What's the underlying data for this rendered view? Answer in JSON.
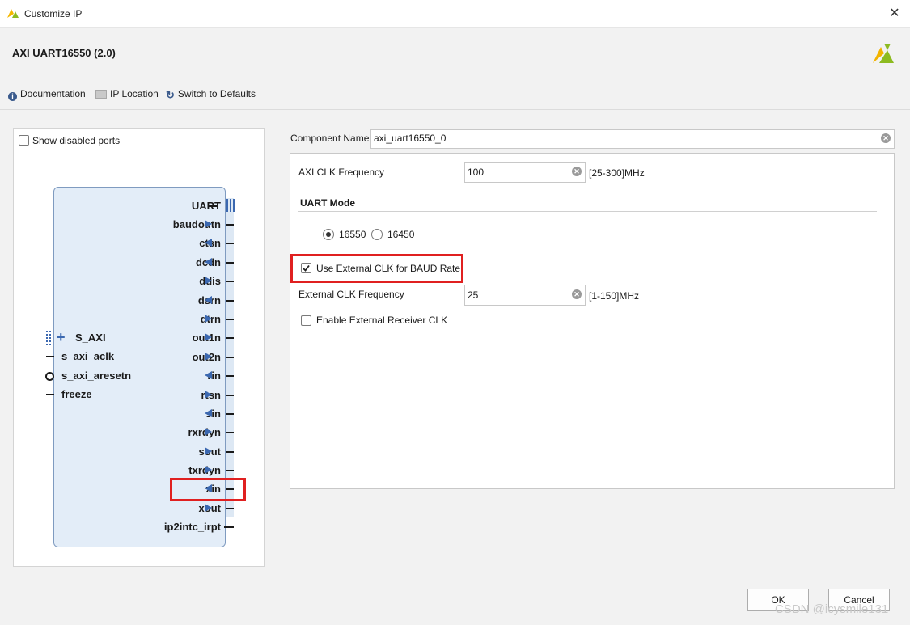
{
  "window": {
    "title": "Customize IP",
    "close_glyph": "✕"
  },
  "header": {
    "ip_name": "AXI UART16550 (2.0)",
    "logo_icon": "xilinx-logo-icon"
  },
  "toolbar": {
    "documentation": "Documentation",
    "ip_location": "IP Location",
    "switch_defaults": "Switch to Defaults"
  },
  "left_panel": {
    "show_disabled_ports": "Show disabled ports",
    "show_disabled_checked": false,
    "block": {
      "right_ports": [
        "UART",
        "baudoutn",
        "ctsn",
        "dcdn",
        "ddis",
        "dsrn",
        "dtrn",
        "out1n",
        "out2n",
        "rin",
        "rtsn",
        "sin",
        "rxrdyn",
        "sout",
        "txrdyn",
        "xin",
        "xout",
        "ip2intc_irpt"
      ],
      "left_ports": [
        "S_AXI",
        "s_axi_aclk",
        "s_axi_aresetn",
        "freeze"
      ]
    }
  },
  "form": {
    "component_name_label": "Component Name",
    "component_name_value": "axi_uart16550_0",
    "axi_clk_label": "AXI CLK Frequency",
    "axi_clk_value": "100",
    "axi_clk_range": "[25-300]MHz",
    "uart_mode_title": "UART Mode",
    "mode_options": [
      "16550",
      "16450"
    ],
    "mode_selected": "16550",
    "use_ext_clk_label": "Use External CLK for BAUD Rate",
    "use_ext_clk_checked": true,
    "ext_clk_label": "External CLK Frequency",
    "ext_clk_value": "25",
    "ext_clk_range": "[1-150]MHz",
    "enable_ext_rx_label": "Enable External Receiver CLK",
    "enable_ext_rx_checked": false
  },
  "buttons": {
    "ok": "OK",
    "cancel": "Cancel"
  },
  "watermark": "CSDN @icysmile131",
  "colors": {
    "highlight": "#e02020",
    "port_arrow": "#3b68b0",
    "block_fill": "#e3edf8"
  }
}
